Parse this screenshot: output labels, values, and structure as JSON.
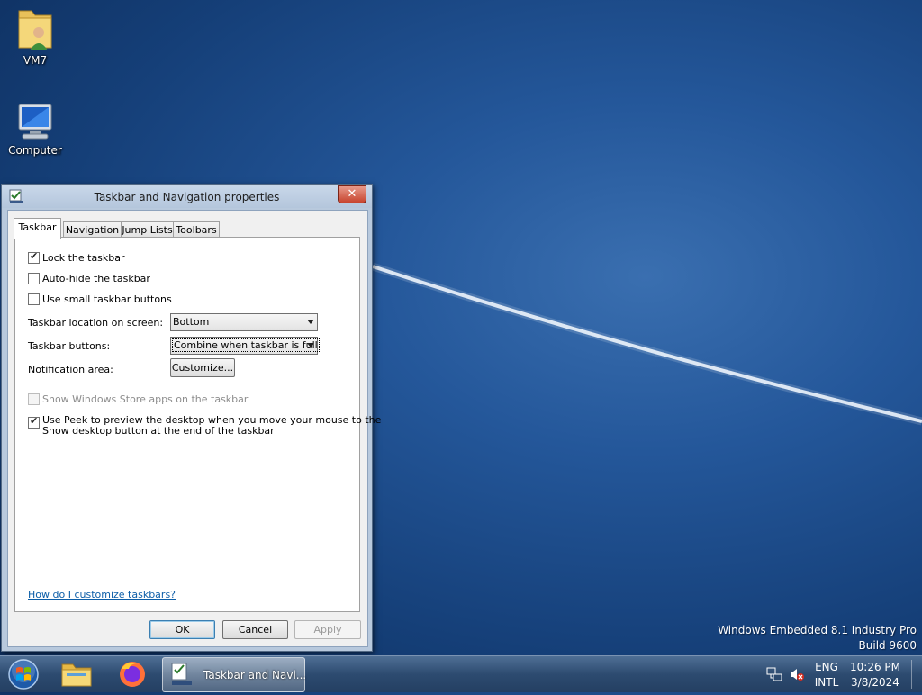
{
  "desktop": {
    "icons": [
      {
        "label": "VM7",
        "icon": "user-folder-icon"
      },
      {
        "label": "Computer",
        "icon": "computer-icon"
      }
    ],
    "watermark": {
      "line1": "Windows Embedded 8.1 Industry Pro",
      "line2": "Build 9600"
    }
  },
  "dialog": {
    "title": "Taskbar and Navigation properties",
    "close_label": "✕",
    "tabs": [
      {
        "label": "Taskbar",
        "active": true
      },
      {
        "label": "Navigation",
        "active": false
      },
      {
        "label": "Jump Lists",
        "active": false
      },
      {
        "label": "Toolbars",
        "active": false
      }
    ],
    "checkboxes": {
      "lock": {
        "label": "Lock the taskbar",
        "checked": true
      },
      "autohide": {
        "label": "Auto-hide the taskbar",
        "checked": false
      },
      "small": {
        "label": "Use small taskbar buttons",
        "checked": false
      },
      "store": {
        "label": "Show Windows Store apps on the taskbar",
        "checked": false,
        "disabled": true
      },
      "peek": {
        "line1": "Use Peek to preview the desktop when you move your mouse to the",
        "line2": "Show desktop button at the end of the taskbar",
        "checked": true
      }
    },
    "location": {
      "label": "Taskbar location on screen:",
      "value": "Bottom"
    },
    "buttons_setting": {
      "label": "Taskbar buttons:",
      "value": "Combine when taskbar is full"
    },
    "notification": {
      "label": "Notification area:",
      "button": "Customize..."
    },
    "help_link": "How do I customize taskbars?",
    "ok": "OK",
    "cancel": "Cancel",
    "apply": "Apply"
  },
  "taskbar": {
    "start": "start-orb-icon",
    "pinned": [
      "file-explorer-icon",
      "firefox-icon"
    ],
    "active_window": "Taskbar and Navi...",
    "tray": {
      "language_top": "ENG",
      "language_bottom": "INTL",
      "time": "10:26 PM",
      "date": "3/8/2024"
    }
  }
}
